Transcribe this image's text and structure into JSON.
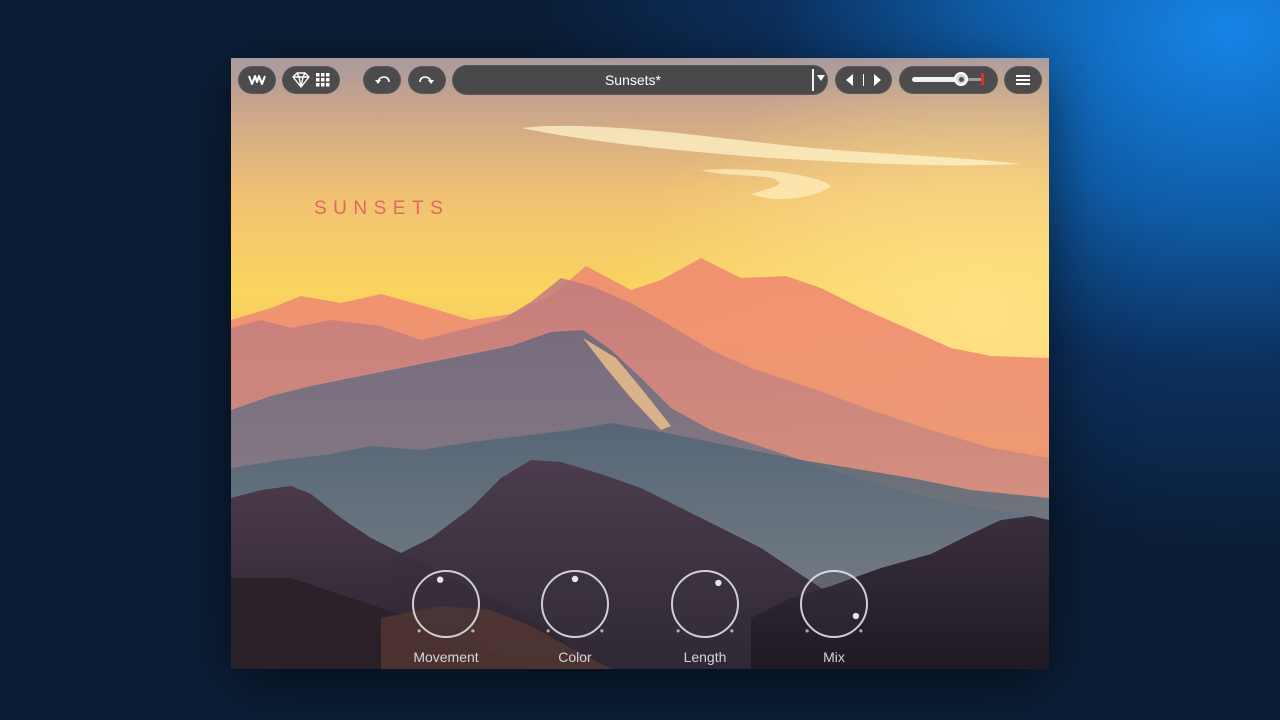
{
  "toolbar": {
    "logo_icon": "waves-logo-icon",
    "presets_icons": [
      "diamond-icon",
      "grid-icon"
    ],
    "undo_icon": "undo-icon",
    "redo_icon": "redo-icon",
    "preset_name": "Sunsets*",
    "preset_dropdown_icon": "caret-down-icon",
    "prev_icon": "triangle-left-icon",
    "next_icon": "triangle-right-icon",
    "output_level": 0.7,
    "menu_icon": "hamburger-menu-icon"
  },
  "main": {
    "title": "SUNSETS",
    "title_color": "#e2685f"
  },
  "knobs": [
    {
      "label": "Movement",
      "value": 0.45
    },
    {
      "label": "Color",
      "value": 0.5
    },
    {
      "label": "Length",
      "value": 0.62
    },
    {
      "label": "Mix",
      "value": 0.94
    }
  ]
}
